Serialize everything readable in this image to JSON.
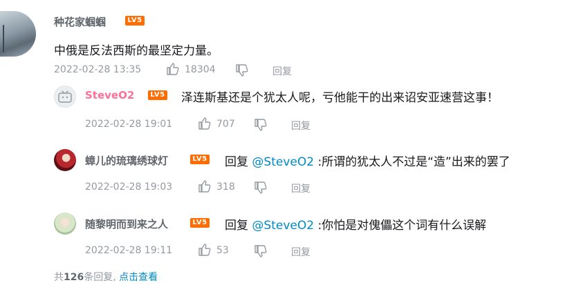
{
  "main_comment": {
    "username": "种花家蝈蝈",
    "level": "LV5",
    "content": "中俄是反法西斯的最坚定力量。",
    "timestamp": "2022-02-28 13:35",
    "likes": "18304",
    "reply_label": "回复"
  },
  "replies": [
    {
      "username": "SteveO2",
      "level": "LV5",
      "content": "泽连斯基还是个犹太人呢，亏他能干的出来诏安亚速营这事！",
      "timestamp": "2022-02-28 19:01",
      "likes": "707",
      "reply_label": "回复"
    },
    {
      "username": "蟑儿的琉璃绣球灯",
      "level": "LV5",
      "reply_prefix": "回复",
      "mention": "@SteveO2",
      "content": ":所谓的犹太人不过是“造”出来的罢了",
      "timestamp": "2022-02-28 19:03",
      "likes": "318",
      "reply_label": "回复"
    },
    {
      "username": "随黎明而到来之人",
      "level": "LV5",
      "reply_prefix": "回复",
      "mention": "@SteveO2",
      "content": ":你怕是对傀儡这个词有什么误解",
      "timestamp": "2022-02-28 19:11",
      "likes": "53",
      "reply_label": "回复"
    }
  ],
  "footer": {
    "prefix": "共",
    "count": "126",
    "suffix": "条回复,",
    "more_label": "点击查看"
  },
  "colors": {
    "level_badge": "#ff6c00",
    "mention": "#008ac5",
    "steve_name": "#fb7299",
    "meta": "#9499a0"
  }
}
